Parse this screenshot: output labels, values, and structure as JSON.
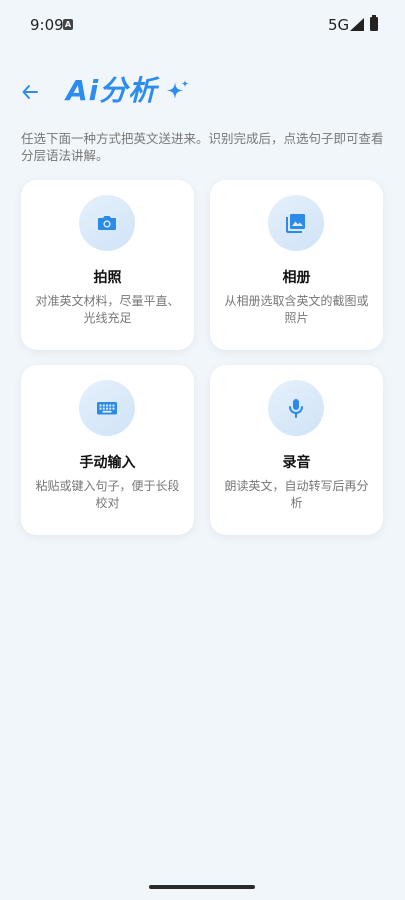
{
  "status": {
    "time": "9:09",
    "network": "5G"
  },
  "header": {
    "title": "Ai分析"
  },
  "intro": "任选下面一种方式把英文送进来。识别完成后，点选句子即可查看分层语法讲解。",
  "cards": [
    {
      "title": "拍照",
      "desc": "对准英文材料，尽量平直、光线充足",
      "icon": "camera-icon"
    },
    {
      "title": "相册",
      "desc": "从相册选取含英文的截图或照片",
      "icon": "photo-album-icon"
    },
    {
      "title": "手动输入",
      "desc": "粘贴或键入句子，便于长段校对",
      "icon": "keyboard-icon"
    },
    {
      "title": "录音",
      "desc": "朗读英文，自动转写后再分析",
      "icon": "microphone-icon"
    }
  ],
  "colors": {
    "accent": "#2d8cef",
    "icon_blue": "#2b8be6",
    "background": "#f1f6fa"
  }
}
